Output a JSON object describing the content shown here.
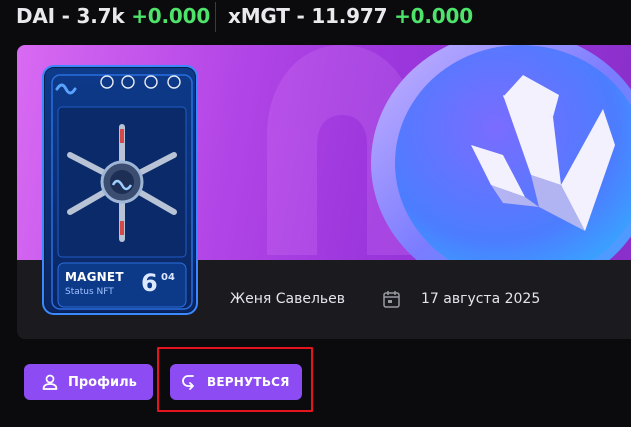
{
  "ticker": [
    {
      "name": "DAI - 3.7k",
      "delta": "+0.000"
    },
    {
      "name": "xMGT - 11.977",
      "delta": "+0.000"
    }
  ],
  "nft": {
    "title": "MAGNET",
    "subtitle": "Status NFT",
    "level": "6",
    "level_sup": "04"
  },
  "meta": {
    "author": "Женя Савельев",
    "date": "17 августа 2025"
  },
  "buttons": {
    "profile": "Профиль",
    "back": "ВЕРНУТЬСЯ"
  },
  "colors": {
    "accent": "#8d4cf3",
    "positive": "#4ee36a",
    "highlight": "#e6141c",
    "banner": "#b245e6"
  }
}
